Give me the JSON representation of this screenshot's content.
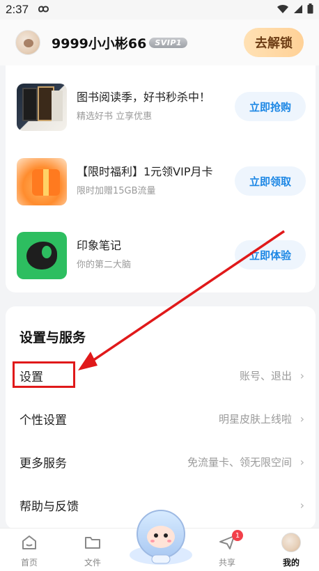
{
  "status_bar": {
    "time": "2:37",
    "sync_icon": "infinity-icon"
  },
  "header": {
    "username": "9999小小彬66",
    "vip_badge": "SVIP1",
    "unlock_label": "去解锁"
  },
  "promos": [
    {
      "title": "图书阅读季，好书秒杀中！",
      "subtitle": "精选好书 立享优惠",
      "action": "立即抢购",
      "icon": "books-icon"
    },
    {
      "title": "【限时福利】1元领VIP月卡",
      "subtitle": "限时加赠15GB流量",
      "action": "立即领取",
      "icon": "gift-icon"
    },
    {
      "title": "印象笔记",
      "subtitle": "你的第二大脑",
      "action": "立即体验",
      "icon": "evernote-icon"
    }
  ],
  "settings": {
    "section_title": "设置与服务",
    "rows": [
      {
        "label": "设置",
        "hint": "账号、退出"
      },
      {
        "label": "个性设置",
        "hint": "明星皮肤上线啦"
      },
      {
        "label": "更多服务",
        "hint": "免流量卡、领无限空间"
      },
      {
        "label": "帮助与反馈",
        "hint": ""
      }
    ]
  },
  "bottom_nav": {
    "items": [
      {
        "label": "首页",
        "icon": "home-icon"
      },
      {
        "label": "文件",
        "icon": "folder-icon"
      },
      {
        "label": "共享",
        "icon": "share-icon",
        "badge": "1"
      },
      {
        "label": "我的",
        "icon": "profile-avatar-icon"
      }
    ],
    "active": "我的"
  },
  "colors": {
    "accent_blue": "#1e88e5",
    "annotation_red": "#e0191a",
    "unlock_gradient_start": "#ffe1b4",
    "unlock_gradient_end": "#ffd197"
  }
}
